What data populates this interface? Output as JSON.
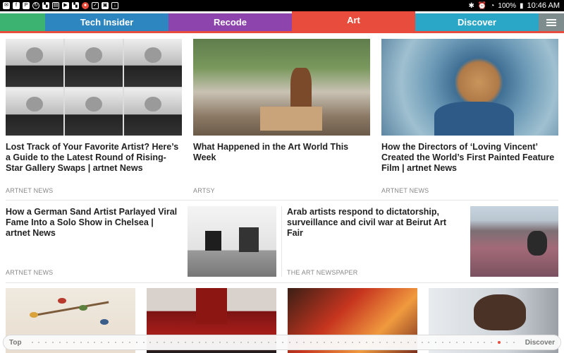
{
  "status_bar": {
    "battery": "100%",
    "time": "10:46 AM"
  },
  "tabs": [
    {
      "label": "",
      "color": "#3cb371"
    },
    {
      "label": "Tech Insider",
      "color": "#2e86c1"
    },
    {
      "label": "Recode",
      "color": "#8e44ad"
    },
    {
      "label": "Art",
      "color": "#e74c3c",
      "active": true
    },
    {
      "label": "Discover",
      "color": "#2aa6c6"
    }
  ],
  "menu_tab_color": "#7f8c8d",
  "articles": {
    "a1": {
      "title": "Lost Track of Your Favorite Artist? Here’s a Guide to the Latest Round of Rising-Star Gallery Swaps | artnet News",
      "source": "ARTNET NEWS"
    },
    "a2": {
      "title": "What Happened in the Art World This Week",
      "source": "ARTSY"
    },
    "a3": {
      "title": "How the Directors of ‘Loving Vincent’ Created the World’s First Painted Feature Film | artnet News",
      "source": "ARTNET NEWS"
    },
    "a4": {
      "title": "How a German Sand Artist Parlayed Viral Fame Into a Solo Show in Chelsea | artnet News",
      "source": "ARTNET NEWS"
    },
    "a5": {
      "title": "Arab artists respond to dictatorship, surveillance and civil war at Beirut Art Fair",
      "source": "THE ART NEWSPAPER"
    }
  },
  "scrubber": {
    "start_label": "Top",
    "end_label": "Discover"
  }
}
